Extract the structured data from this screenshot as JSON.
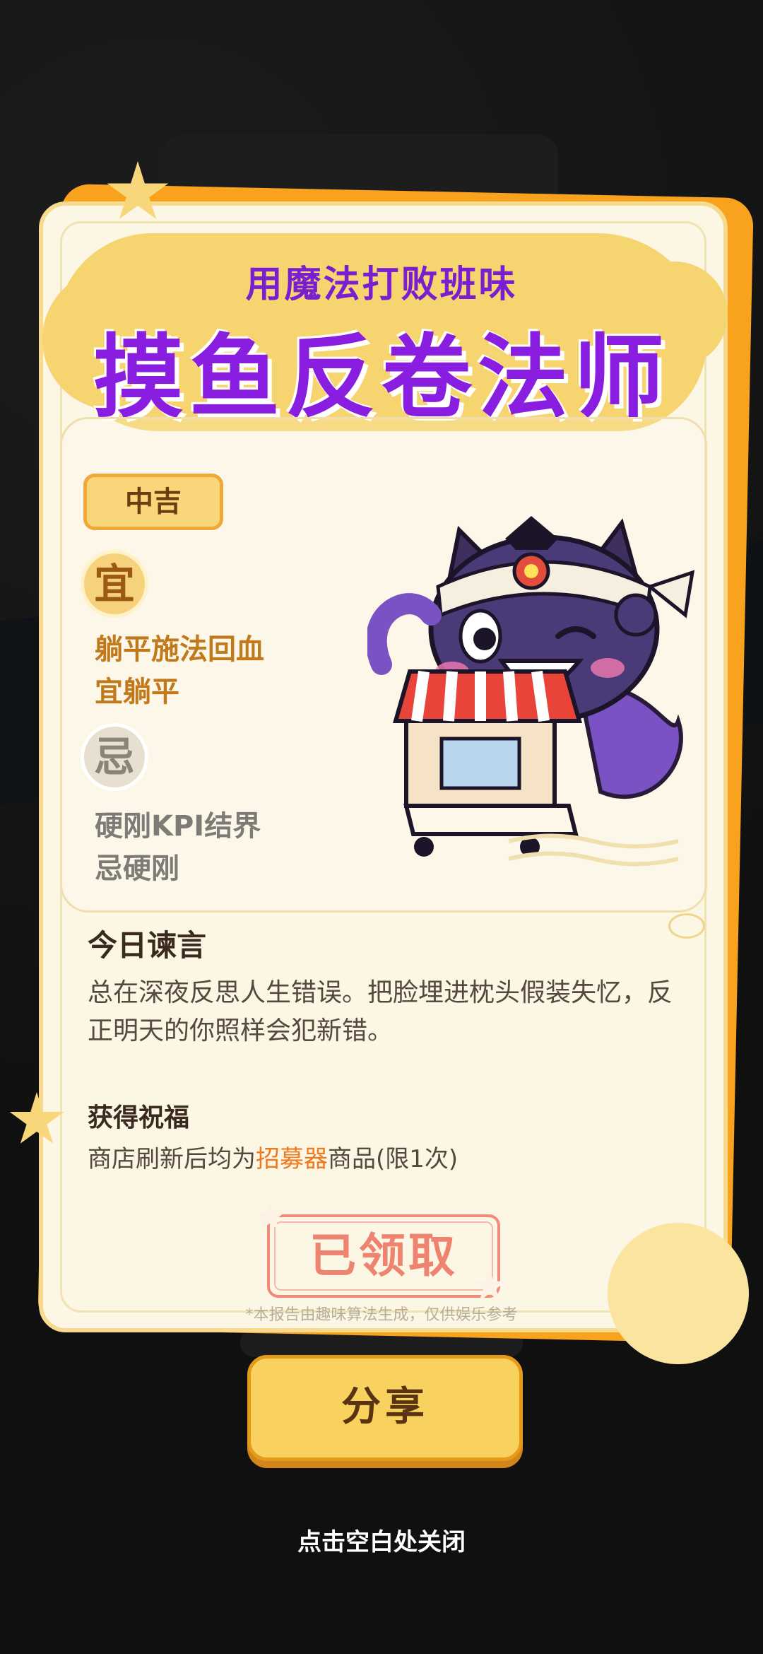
{
  "card": {
    "subtitle": "用魔法打败班味",
    "title": "摸鱼反卷法师",
    "fortune_badge": "中吉",
    "yi": {
      "symbol": "宜",
      "lines": [
        "躺平施法回血",
        "宜躺平"
      ]
    },
    "ji": {
      "symbol": "忌",
      "lines": [
        "硬刚KPI结界",
        "忌硬刚"
      ]
    },
    "advice": {
      "heading": "今日谏言",
      "text": "总在深夜反思人生错误。把脸埋进枕头假装失忆，反正明天的你照样会犯新错。"
    },
    "blessing": {
      "heading": "获得祝福",
      "prefix": "商店刷新后均为",
      "highlight": "招募器",
      "suffix": "商品(限1次)"
    },
    "claimed_stamp": "已领取",
    "disclaimer": "*本报告由趣味算法生成，仅供娱乐参考"
  },
  "share_button": "分享",
  "close_hint": "点击空白处关闭",
  "mascot_icon": "purple-cat-wizard-with-shopping-cart",
  "colors": {
    "card_bg": "#fcf6e4",
    "accent_orange": "#f8a21d",
    "title_purple": "#8a1ee0",
    "cloud_yellow": "#f6d470",
    "highlight": "#ee7a1f"
  }
}
